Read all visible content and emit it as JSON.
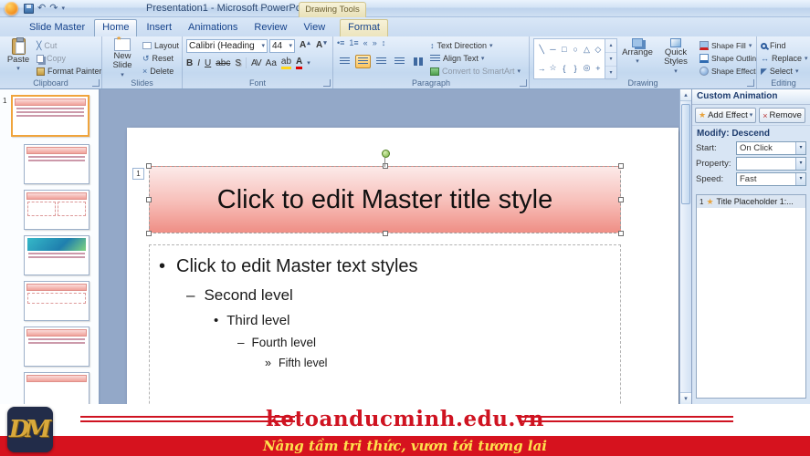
{
  "colors": {
    "accent_red": "#cf1321",
    "footer_red": "#d6121e",
    "slogan_yellow": "#ffe14d",
    "selection_orange": "#f0a43c",
    "title_fill": "#ef8e85"
  },
  "icons": {
    "chevron_down": "▾",
    "chevron_up": "▴",
    "undo": "↶",
    "redo": "↷",
    "star": "★",
    "close": "×",
    "scissors": "╳",
    "updown": "↕",
    "reset": "↺",
    "bullet_list": "•≡",
    "numbered_list": "1≡",
    "indent_dec": "«",
    "indent_inc": "»",
    "shapes": [
      "╲",
      "─",
      "□",
      "○",
      "△",
      "◇",
      "→",
      "☆",
      "{",
      "}",
      "◎",
      "+"
    ]
  },
  "titlebar": {
    "title": "Presentation1 - Microsoft PowerPoint",
    "contextual_group": "Drawing Tools"
  },
  "tabs": [
    {
      "label": "Slide Master"
    },
    {
      "label": "Home"
    },
    {
      "label": "Insert"
    },
    {
      "label": "Animations"
    },
    {
      "label": "Review"
    },
    {
      "label": "View"
    },
    {
      "label": "Format"
    }
  ],
  "ribbon": {
    "clipboard": {
      "label": "Clipboard",
      "paste": "Paste",
      "cut": "Cut",
      "copy": "Copy",
      "format_painter": "Format Painter"
    },
    "slides": {
      "label": "Slides",
      "new_slide": "New Slide",
      "layout": "Layout",
      "reset": "Reset",
      "delete": "Delete"
    },
    "font": {
      "label": "Font",
      "font_name": "Calibri (Heading",
      "font_size": "44",
      "bold": "B",
      "italic": "I",
      "underline": "U",
      "strike": "abc",
      "shadow": "S",
      "char_spacing": "AV",
      "change_case": "Aa",
      "grow": "A",
      "shrink": "A",
      "highlight": "ab",
      "font_color": "A"
    },
    "paragraph": {
      "label": "Paragraph",
      "text_direction": "Text Direction",
      "align_text": "Align Text",
      "smartart": "Convert to SmartArt"
    },
    "drawing": {
      "label": "Drawing",
      "arrange": "Arrange",
      "quick_styles": "Quick Styles",
      "shape_fill": "Shape Fill",
      "shape_outline": "Shape Outline",
      "shape_effects": "Shape Effects"
    },
    "editing": {
      "label": "Editing",
      "find": "Find",
      "replace": "Replace",
      "select": "Select"
    }
  },
  "thumbnails": {
    "master_number": "1"
  },
  "slide": {
    "number": "1",
    "title": "Click to edit Master title style",
    "bullets": [
      {
        "marker": "•",
        "text": "Click to edit Master text styles"
      },
      {
        "marker": "–",
        "text": "Second level"
      },
      {
        "marker": "•",
        "text": "Third level"
      },
      {
        "marker": "–",
        "text": "Fourth level"
      },
      {
        "marker": "»",
        "text": "Fifth level"
      }
    ]
  },
  "animation_pane": {
    "title": "Custom Animation",
    "add_effect": "Add Effect",
    "remove": "Remove",
    "modify": "Modify: Descend",
    "start_label": "Start:",
    "start_value": "On Click",
    "property_label": "Property:",
    "property_value": "",
    "speed_label": "Speed:",
    "speed_value": "Fast",
    "items": [
      {
        "index": "1",
        "label": "Title Placeholder 1:..."
      }
    ]
  },
  "footer": {
    "logo": "DM",
    "site": "ketoanducminh.edu.vn",
    "slogan": "Nâng tầm tri thức, vươn tới tương lai"
  }
}
